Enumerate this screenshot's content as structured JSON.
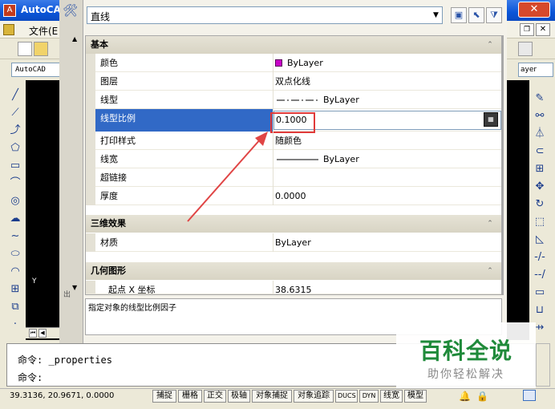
{
  "app": {
    "title": "AutoCA",
    "menu_file": "文件(E",
    "close_symbol": "✕",
    "style_combo": "AutoCAD",
    "right_combo": "ayer"
  },
  "palette": {
    "object_type": "直线",
    "categories": {
      "basic": "基本",
      "effects3d": "三维效果",
      "geometry": "几何图形"
    },
    "rows": [
      {
        "name": "颜色",
        "value": "ByLayer"
      },
      {
        "name": "图层",
        "value": "双点化线"
      },
      {
        "name": "线型",
        "value": "ByLayer"
      },
      {
        "name": "线型比例",
        "value": "0.1000"
      },
      {
        "name": "打印样式",
        "value": "随颜色"
      },
      {
        "name": "线宽",
        "value": "ByLayer"
      },
      {
        "name": "超链接",
        "value": ""
      },
      {
        "name": "厚度",
        "value": "0.0000"
      }
    ],
    "material": {
      "name": "材质",
      "value": "ByLayer"
    },
    "start_x": {
      "name": "起点 X 坐标",
      "value": "38.6315"
    },
    "description": "指定对象的线型比例因子",
    "accent_color": "#3169c6",
    "highlight_color": "#e03a3a",
    "strip_label": "出"
  },
  "command": {
    "line1": "命令: _properties",
    "line2": "命令:"
  },
  "status": {
    "coords": "39.3136, 20.9671, 0.0000",
    "buttons": [
      "捕捉",
      "栅格",
      "正交",
      "极轴",
      "对象捕捉",
      "对象追踪",
      "DUCS",
      "DYN",
      "线宽",
      "模型"
    ]
  },
  "drawing": {
    "ucs_y": "Y"
  },
  "watermark": {
    "title": "百科全说",
    "subtitle": "助你轻松解决"
  }
}
